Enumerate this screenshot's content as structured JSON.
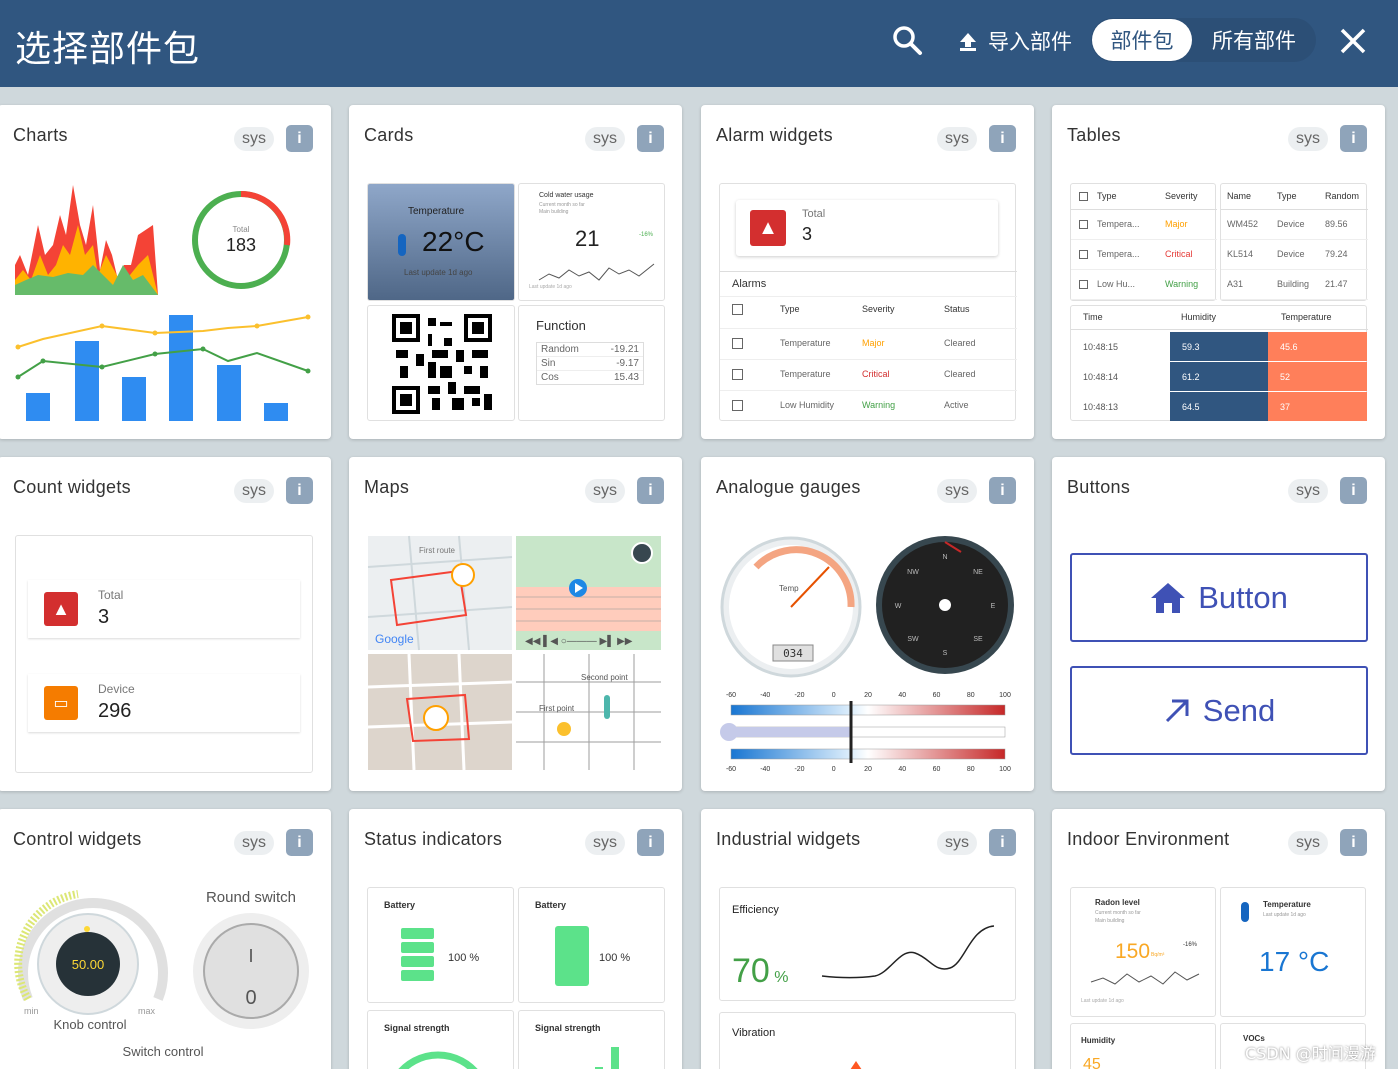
{
  "header": {
    "title": "选择部件包",
    "import_label": "导入部件",
    "toggle_active": "部件包",
    "toggle_inactive": "所有部件"
  },
  "card_common": {
    "sys": "sys",
    "info": "i"
  },
  "cards": [
    {
      "title": "Charts"
    },
    {
      "title": "Cards"
    },
    {
      "title": "Alarm widgets"
    },
    {
      "title": "Tables"
    },
    {
      "title": "Count widgets"
    },
    {
      "title": "Maps"
    },
    {
      "title": "Analogue gauges"
    },
    {
      "title": "Buttons"
    },
    {
      "title": "Control widgets"
    },
    {
      "title": "Status indicators"
    },
    {
      "title": "Industrial widgets"
    },
    {
      "title": "Indoor Environment"
    }
  ],
  "charts_preview": {
    "donut_label": "Total",
    "donut_value": "183"
  },
  "cards_preview": {
    "temp_title": "Temperature",
    "temp_value": "22°C",
    "temp_sub": "Last update 1d ago",
    "water_title": "Cold water usage",
    "water_sub1": "Current month so far",
    "water_sub2": "Main building",
    "water_value": "21",
    "water_delta": "-16%",
    "water_foot": "Last update 1d ago",
    "func_title": "Function",
    "func_rows": [
      [
        "Random",
        "-19.21"
      ],
      [
        "Sin",
        "-9.17"
      ],
      [
        "Cos",
        "15.43"
      ]
    ]
  },
  "alarm_preview": {
    "total_label": "Total",
    "total_value": "3",
    "alarms_title": "Alarms",
    "headers": [
      "Type",
      "Severity",
      "Status"
    ],
    "rows": [
      {
        "type": "Temperature",
        "severity": "Major",
        "status": "Cleared",
        "color": "#ffa000"
      },
      {
        "type": "Temperature",
        "severity": "Critical",
        "status": "Cleared",
        "color": "#d32f2f"
      },
      {
        "type": "Low Humidity",
        "severity": "Warning",
        "status": "Active",
        "color": "#43a047"
      }
    ]
  },
  "tables_preview": {
    "t1_headers": [
      "Type",
      "Severity"
    ],
    "t1_rows": [
      [
        "Tempera...",
        "Major",
        "#ffa000"
      ],
      [
        "Tempera...",
        "Critical",
        "#e53935"
      ],
      [
        "Low Hu...",
        "Warning",
        "#43a047"
      ]
    ],
    "t2_headers": [
      "Name",
      "Type",
      "Random"
    ],
    "t2_rows": [
      [
        "WM452",
        "Device",
        "89.56"
      ],
      [
        "KL514",
        "Device",
        "79.24"
      ],
      [
        "A31",
        "Building",
        "21.47"
      ]
    ],
    "t3_headers": [
      "Time",
      "Humidity",
      "Temperature"
    ],
    "t3_rows": [
      [
        "10:48:15",
        "59.3",
        "45.6"
      ],
      [
        "10:48:14",
        "61.2",
        "52"
      ],
      [
        "10:48:13",
        "64.5",
        "37"
      ]
    ]
  },
  "count_preview": [
    {
      "label": "Total",
      "value": "3",
      "color": "#d32f2f"
    },
    {
      "label": "Device",
      "value": "296",
      "color": "#f57c00"
    }
  ],
  "maps_preview": {
    "first_route": "First route",
    "second_point": "Second point",
    "first_point": "First point",
    "logo": "Google"
  },
  "gauges_preview": {
    "temp_label": "Temp",
    "odometer": "034",
    "compass": [
      "N",
      "NE",
      "E",
      "SE",
      "S",
      "SW",
      "W",
      "NW"
    ],
    "scale": [
      "-60",
      "-40",
      "-20",
      "0",
      "20",
      "40",
      "60",
      "80",
      "100"
    ],
    "dial_ticks": [
      "-20",
      "0",
      "20",
      "40",
      "60",
      "80",
      "100",
      "-40",
      "-60"
    ]
  },
  "buttons_preview": {
    "button1": "Button",
    "button2": "Send"
  },
  "control_preview": {
    "knob_value": "50.00",
    "min": "min",
    "max": "max",
    "knob_label": "Knob control",
    "round_switch": "Round switch",
    "switch_on": "I",
    "switch_off": "0",
    "switch_control": "Switch control"
  },
  "status_preview": {
    "battery1": "Battery",
    "battery2": "Battery",
    "pct1": "100 %",
    "pct2": "100 %",
    "signal1": "Signal strength",
    "signal2": "Signal strength"
  },
  "industrial_preview": {
    "eff_label": "Efficiency",
    "eff_value": "70",
    "eff_unit": "%",
    "vib_label": "Vibration"
  },
  "indoor_preview": {
    "radon_title": "Radon level",
    "radon_sub1": "Current month so far",
    "radon_sub2": "Main building",
    "radon_value": "150",
    "radon_unit": "Bq/m³",
    "radon_delta": "-16%",
    "radon_foot": "Last update 1d ago",
    "temp_title": "Temperature",
    "temp_sub": "Last update 1d ago",
    "temp_value": "17 °C",
    "humidity": "Humidity",
    "humidity_value": "45",
    "voc": "VOCs"
  },
  "watermark": "CSDN @时间漫游"
}
